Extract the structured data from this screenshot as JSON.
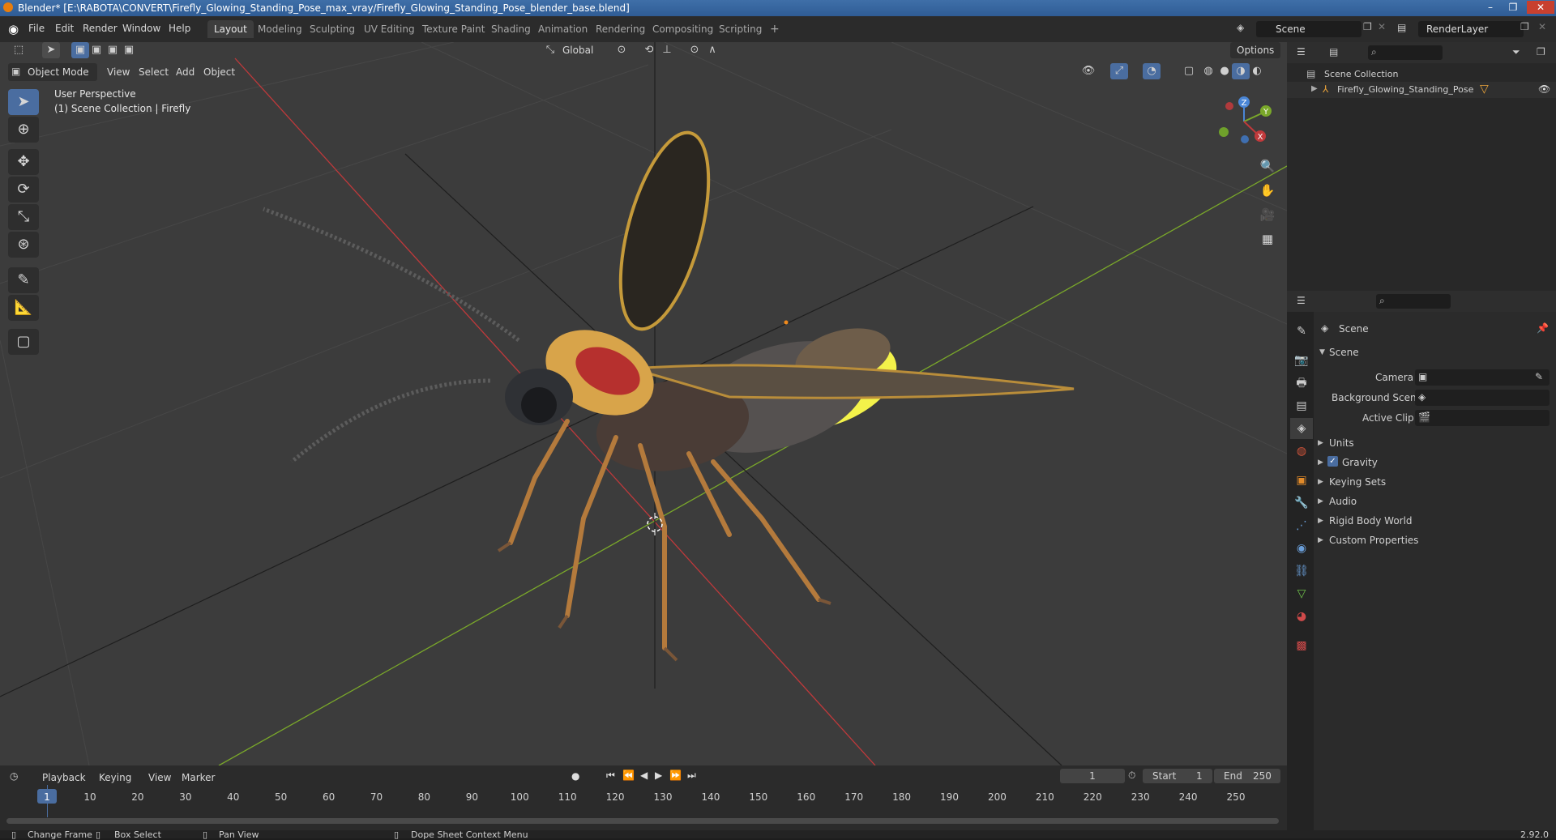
{
  "window": {
    "title": "Blender* [E:\\RABOTA\\CONVERT\\Firefly_Glowing_Standing_Pose_max_vray/Firefly_Glowing_Standing_Pose_blender_base.blend]",
    "minimize": "–",
    "maximize": "❐",
    "close": "✕"
  },
  "menu": [
    "File",
    "Edit",
    "Render",
    "Window",
    "Help"
  ],
  "workspaces": [
    "Layout",
    "Modeling",
    "Sculpting",
    "UV Editing",
    "Texture Paint",
    "Shading",
    "Animation",
    "Rendering",
    "Compositing",
    "Scripting"
  ],
  "active_workspace": "Layout",
  "add_workspace": "+",
  "scene_field": "Scene",
  "renderlayer_field": "RenderLayer",
  "viewport": {
    "orientation": "Global",
    "options": "Options",
    "mode": "Object Mode",
    "menus": [
      "View",
      "Select",
      "Add",
      "Object"
    ],
    "overlay_line1": "User Perspective",
    "overlay_line2": "(1) Scene Collection | Firefly",
    "gizmo": {
      "z": "Z",
      "y": "Y",
      "x": "X"
    }
  },
  "outliner": {
    "root": "Scene Collection",
    "items": [
      "Firefly_Glowing_Standing_Pose"
    ]
  },
  "properties": {
    "context": "Scene",
    "panel": "Scene",
    "fields": [
      {
        "label": "Camera"
      },
      {
        "label": "Background Scene"
      },
      {
        "label": "Active Clip"
      }
    ],
    "sections": [
      "Units",
      "Gravity",
      "Keying Sets",
      "Audio",
      "Rigid Body World",
      "Custom Properties"
    ],
    "gravity_checked": true
  },
  "timeline": {
    "menus": [
      "Playback",
      "Keying",
      "View",
      "Marker"
    ],
    "current_frame": "1",
    "start_label": "Start",
    "start": "1",
    "end_label": "End",
    "end": "250",
    "ticks": [
      "1",
      "10",
      "20",
      "30",
      "40",
      "50",
      "60",
      "70",
      "80",
      "90",
      "100",
      "110",
      "120",
      "130",
      "140",
      "150",
      "160",
      "170",
      "180",
      "190",
      "200",
      "210",
      "220",
      "230",
      "240",
      "250"
    ]
  },
  "statusbar": {
    "items": [
      "Change Frame",
      "Box Select",
      "Pan View",
      "Dope Sheet Context Menu"
    ],
    "version": "2.92.0"
  },
  "colors": {
    "accent": "#4a6da0",
    "x_axis": "#c0393b",
    "y_axis": "#7aa82a",
    "glow": "#f3f24a"
  }
}
